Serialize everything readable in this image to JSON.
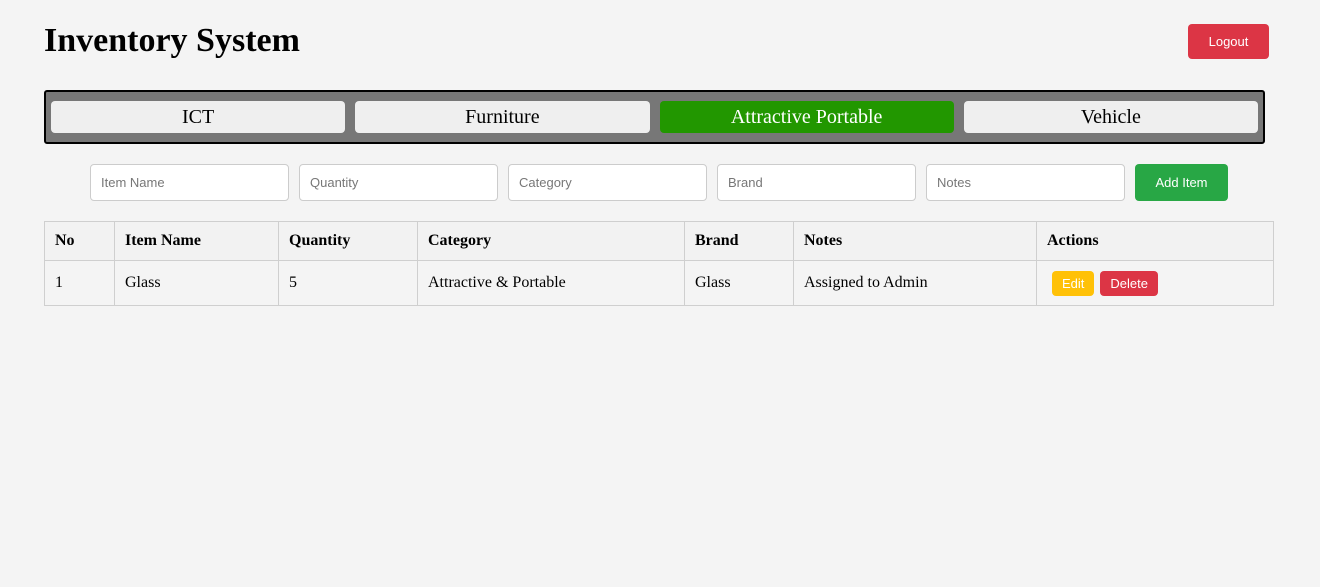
{
  "header": {
    "title": "Inventory System",
    "logout_label": "Logout"
  },
  "tabs": [
    {
      "label": "ICT",
      "active": false
    },
    {
      "label": "Furniture",
      "active": false
    },
    {
      "label": "Attractive Portable",
      "active": true
    },
    {
      "label": "Vehicle",
      "active": false
    }
  ],
  "form": {
    "item_name_placeholder": "Item Name",
    "quantity_placeholder": "Quantity",
    "category_placeholder": "Category",
    "brand_placeholder": "Brand",
    "notes_placeholder": "Notes",
    "add_label": "Add Item"
  },
  "table": {
    "headers": [
      "No",
      "Item Name",
      "Quantity",
      "Category",
      "Brand",
      "Notes",
      "Actions"
    ],
    "rows": [
      {
        "no": "1",
        "item_name": "Glass",
        "quantity": "5",
        "category": "Attractive & Portable",
        "brand": "Glass",
        "notes": "Assigned to Admin",
        "edit_label": "Edit",
        "delete_label": "Delete"
      }
    ]
  },
  "colors": {
    "active_tab": "#229700",
    "logout": "#dc3545",
    "add": "#28a745",
    "edit": "#ffc107",
    "delete": "#dc3545"
  }
}
